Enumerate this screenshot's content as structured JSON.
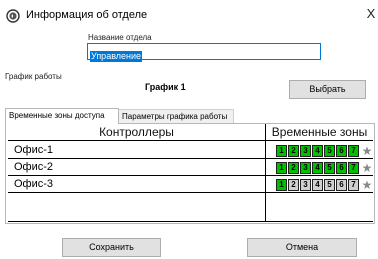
{
  "window": {
    "title": "Информация об отделе",
    "close_glyph": "X"
  },
  "department": {
    "label": "Название отдела",
    "value": "Управление"
  },
  "schedule": {
    "label": "График работы",
    "name": "График 1",
    "choose_label": "Выбрать"
  },
  "tabs": [
    {
      "label": "Временные зоны доступа",
      "active": true
    },
    {
      "label": "Параметры графика работы",
      "active": false
    }
  ],
  "table": {
    "headers": {
      "controllers": "Контроллеры",
      "time_zones": "Временные зоны"
    },
    "rows": [
      {
        "name": "Офис-1",
        "zones": [
          {
            "n": "1",
            "on": true
          },
          {
            "n": "2",
            "on": true
          },
          {
            "n": "3",
            "on": true
          },
          {
            "n": "4",
            "on": true
          },
          {
            "n": "5",
            "on": true
          },
          {
            "n": "6",
            "on": true
          },
          {
            "n": "7",
            "on": true
          }
        ]
      },
      {
        "name": "Офис-2",
        "zones": [
          {
            "n": "1",
            "on": true
          },
          {
            "n": "2",
            "on": true
          },
          {
            "n": "3",
            "on": true
          },
          {
            "n": "4",
            "on": true
          },
          {
            "n": "5",
            "on": true
          },
          {
            "n": "6",
            "on": true
          },
          {
            "n": "7",
            "on": true
          }
        ]
      },
      {
        "name": "Офис-3",
        "zones": [
          {
            "n": "1",
            "on": true
          },
          {
            "n": "2",
            "on": false
          },
          {
            "n": "3",
            "on": false
          },
          {
            "n": "4",
            "on": false
          },
          {
            "n": "5",
            "on": false
          },
          {
            "n": "6",
            "on": false
          },
          {
            "n": "7",
            "on": false
          }
        ]
      }
    ],
    "star_icon": "star-icon"
  },
  "buttons": {
    "save": "Сохранить",
    "cancel": "Отмена"
  },
  "colors": {
    "zone_on": "#00c000",
    "zone_off": "#d0d0d0",
    "selection": "#0078d7"
  }
}
